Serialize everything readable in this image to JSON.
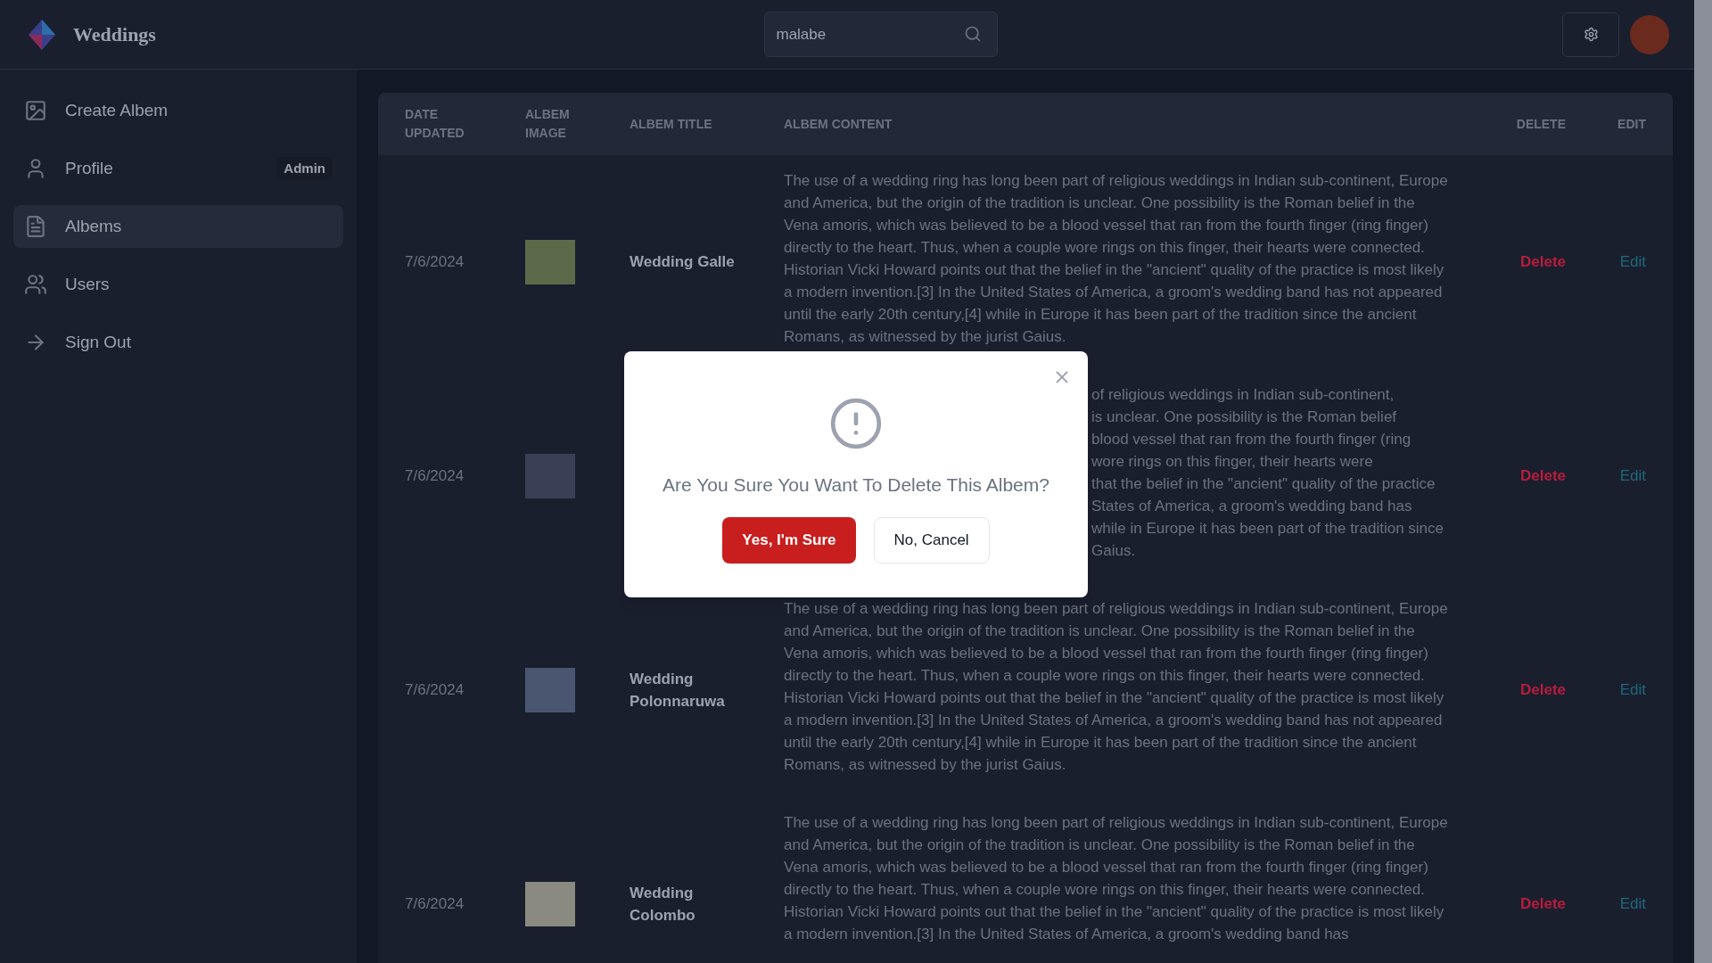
{
  "header": {
    "brand": "Weddings",
    "search": {
      "value": "malabe"
    }
  },
  "sidebar": {
    "items": [
      {
        "kind": "image",
        "label": "Create Albem",
        "selected": false
      },
      {
        "kind": "user",
        "label": "Profile",
        "badge": "Admin",
        "selected": false
      },
      {
        "kind": "document",
        "label": "Albems",
        "selected": true
      },
      {
        "kind": "users",
        "label": "Users",
        "selected": false
      },
      {
        "kind": "arrow",
        "label": "Sign Out",
        "selected": false
      }
    ]
  },
  "table": {
    "columns": [
      "DATE UPDATED",
      "ALBEM IMAGE",
      "ALBEM TITLE",
      "ALBEM CONTENT",
      "DELETE",
      "EDIT"
    ],
    "rows": [
      {
        "date": "7/6/2024",
        "title": "Wedding Galle",
        "content": "The use of a wedding ring has long been part of religious weddings in Indian sub-continent, Europe and America, but the origin of the tradition is unclear. One possibility is the Roman belief in the Vena amoris, which was believed to be a blood vessel that ran from the fourth finger (ring finger) directly to the heart. Thus, when a couple wore rings on this finger, their hearts were connected. Historian Vicki Howard points out that the belief in the \"ancient\" quality of the practice is most likely a modern invention.[3] In the United States of America, a groom's wedding band has not appeared until the early 20th century,[4] while in Europe it has been part of the tradition since the ancient Romans, as witnessed by the jurist Gaius.",
        "delete": "Delete",
        "edit": "Edit"
      },
      {
        "date": "7/6/2024",
        "content_lines": [
          "of religious weddings in Indian sub-continent,",
          "is unclear. One possibility is the Roman belief",
          "blood vessel that ran from the fourth finger (ring",
          "wore rings on this finger, their hearts were",
          "that the belief in the \"ancient\" quality of the practice",
          "States of America, a groom's wedding band has",
          "while in Europe it has been part of the tradition since",
          "Gaius."
        ],
        "delete": "Delete",
        "edit": "Edit"
      },
      {
        "date": "7/6/2024",
        "title": "Wedding Polonnaruwa",
        "content": "The use of a wedding ring has long been part of religious weddings in Indian sub-continent, Europe and America, but the origin of the tradition is unclear. One possibility is the Roman belief in the Vena amoris, which was believed to be a blood vessel that ran from the fourth finger (ring finger) directly to the heart. Thus, when a couple wore rings on this finger, their hearts were connected. Historian Vicki Howard points out that the belief in the \"ancient\" quality of the practice is most likely a modern invention.[3] In the United States of America, a groom's wedding band has not appeared until the early 20th century,[4] while in Europe it has been part of the tradition since the ancient Romans, as witnessed by the jurist Gaius.",
        "delete": "Delete",
        "edit": "Edit"
      },
      {
        "date": "7/6/2024",
        "title": "Wedding Colombo",
        "content": "The use of a wedding ring has long been part of religious weddings in Indian sub-continent, Europe and America, but the origin of the tradition is unclear. One possibility is the Roman belief in the Vena amoris, which was believed to be a blood vessel that ran from the fourth finger (ring finger) directly to the heart. Thus, when a couple wore rings on this finger, their hearts were connected. Historian Vicki Howard points out that the belief in the \"ancient\" quality of the practice is most likely a modern invention.[3] In the United States of America, a groom's wedding band has",
        "delete": "Delete",
        "edit": "Edit"
      }
    ]
  },
  "modal": {
    "message": "Are You Sure You Want To Delete This Albem?",
    "confirm": "Yes, I'm Sure",
    "cancel": "No, Cancel"
  }
}
